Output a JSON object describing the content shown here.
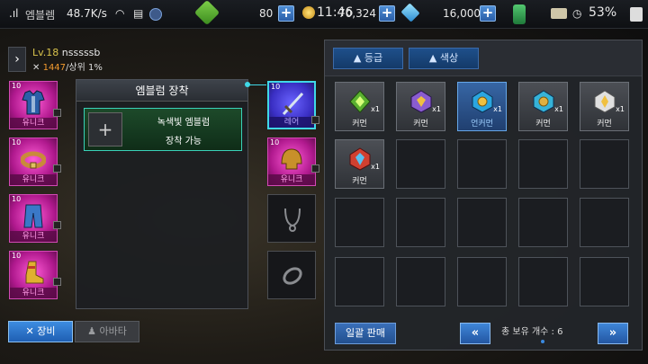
{
  "statusbar": {
    "net_label": "엠블렘",
    "net_speed": "48.7K/s",
    "time": "11:46",
    "battery": "53%"
  },
  "currencies": {
    "stamina": "80",
    "gold": "70,324",
    "gems": "16,000"
  },
  "profile": {
    "level": "Lv.18",
    "name": "nsssssb",
    "rank_value": "1447",
    "rank_suffix": "/상위 1%"
  },
  "equip_slots": {
    "left": [
      {
        "level": "10",
        "grade": "유니크",
        "item": "armor-icon"
      },
      {
        "level": "10",
        "grade": "유니크",
        "item": "belt-icon"
      },
      {
        "level": "10",
        "grade": "유니크",
        "item": "pants-icon"
      },
      {
        "level": "10",
        "grade": "유니크",
        "item": "boots-icon"
      }
    ],
    "right": [
      {
        "level": "10",
        "grade": "레어",
        "item": "sword-icon"
      },
      {
        "level": "10",
        "grade": "유니크",
        "item": "helmet-icon"
      },
      {
        "level": "",
        "grade": "",
        "item": "necklace-icon"
      },
      {
        "level": "",
        "grade": "",
        "item": "ring-icon"
      }
    ]
  },
  "emblem": {
    "title": "엠블럼 장착",
    "slot_name": "녹색빛 엠블럼",
    "slot_status": "장착 가능",
    "add_symbol": "+"
  },
  "tabs": {
    "equip": "장비",
    "avatar": "아바타"
  },
  "inventory": {
    "filters": [
      "▲ 등급",
      "▲ 색상"
    ],
    "items": [
      {
        "grade": "커먼",
        "qty": "x1",
        "color": "#5ab030",
        "icon": "green-gem-icon"
      },
      {
        "grade": "커먼",
        "qty": "x1",
        "color": "#8a5cd0",
        "icon": "purple-gem-icon"
      },
      {
        "grade": "언커먼",
        "qty": "x1",
        "color": "#2aa6e0",
        "icon": "blue-gem-icon"
      },
      {
        "grade": "커먼",
        "qty": "x1",
        "color": "#36b3d8",
        "icon": "cyan-gem-icon"
      },
      {
        "grade": "커먼",
        "qty": "x1",
        "color": "#d8d8d8",
        "icon": "white-gem-icon"
      },
      {
        "grade": "커먼",
        "qty": "x1",
        "color": "#d04030",
        "icon": "red-gem-icon"
      }
    ],
    "sell_all": "일괄 판매",
    "total_label": "총 보유 개수 : 6",
    "prev": "«",
    "next": "»"
  }
}
